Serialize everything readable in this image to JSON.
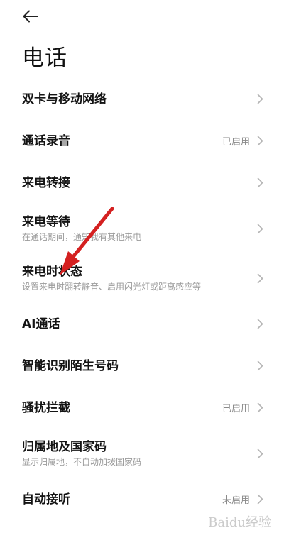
{
  "header": {
    "back_icon": "arrow-left-icon",
    "title": "电话"
  },
  "items": [
    {
      "title": "双卡与移动网络",
      "sub": "",
      "status": ""
    },
    {
      "title": "通话录音",
      "sub": "",
      "status": "已启用"
    },
    {
      "title": "来电转接",
      "sub": "",
      "status": ""
    },
    {
      "title": "来电等待",
      "sub": "在通话期间，通知我有其他来电",
      "status": ""
    },
    {
      "title": "来电时状态",
      "sub": "设置来电时翻转静音、启用闪光灯或距离感应等",
      "status": ""
    },
    {
      "title": "AI通话",
      "sub": "",
      "status": ""
    },
    {
      "title": "智能识别陌生号码",
      "sub": "",
      "status": ""
    },
    {
      "title": "骚扰拦截",
      "sub": "",
      "status": "已启用"
    },
    {
      "title": "归属地及国家码",
      "sub": "显示归属地，不自动加拨国家码",
      "status": ""
    },
    {
      "title": "自动接听",
      "sub": "",
      "status": "未启用"
    }
  ],
  "annotation": {
    "arrow_color": "#d42020",
    "arrow_icon": "red-arrow-pointer"
  },
  "watermark": "Baidu经验",
  "colors": {
    "background": "#ffffff",
    "title_text": "#141414",
    "subtitle_text": "#9b9b9b",
    "status_text": "#8a8a8a",
    "chevron": "#b5b5b5"
  }
}
